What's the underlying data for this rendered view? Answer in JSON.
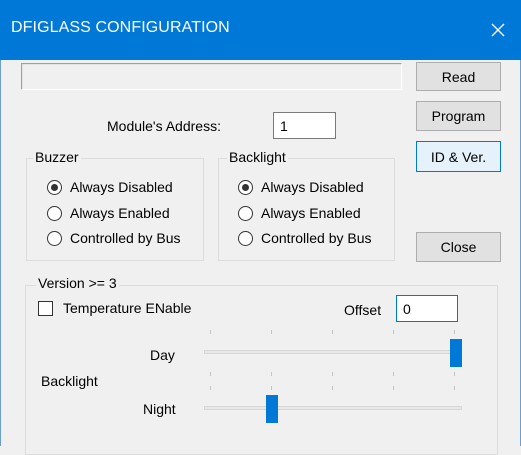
{
  "window": {
    "title": "DFIGLASS CONFIGURATION"
  },
  "status_field": {
    "value": ""
  },
  "buttons": {
    "read": "Read",
    "program": "Program",
    "id_ver": "ID & Ver.",
    "close": "Close"
  },
  "address": {
    "label": "Module's Address:",
    "value": "1"
  },
  "buzzer": {
    "title": "Buzzer",
    "options": [
      {
        "label": "Always Disabled",
        "selected": true
      },
      {
        "label": "Always Enabled",
        "selected": false
      },
      {
        "label": "Controlled by Bus",
        "selected": false
      }
    ]
  },
  "backlight_group": {
    "title": "Backlight",
    "options": [
      {
        "label": "Always Disabled",
        "selected": true
      },
      {
        "label": "Always Enabled",
        "selected": false
      },
      {
        "label": "Controlled by Bus",
        "selected": false
      }
    ]
  },
  "version": {
    "title": "Version >= 3",
    "temperature_enable": {
      "label": "Temperature ENable",
      "checked": false
    },
    "offset": {
      "label": "Offset",
      "value": "0"
    },
    "backlight_label": "Backlight",
    "day": {
      "label": "Day",
      "level": 1.0
    },
    "night": {
      "label": "Night",
      "level": 0.25
    }
  },
  "colors": {
    "title_bar": "#0078d7",
    "accent": "#0078d7",
    "window_bg": "#f0f0f0"
  }
}
